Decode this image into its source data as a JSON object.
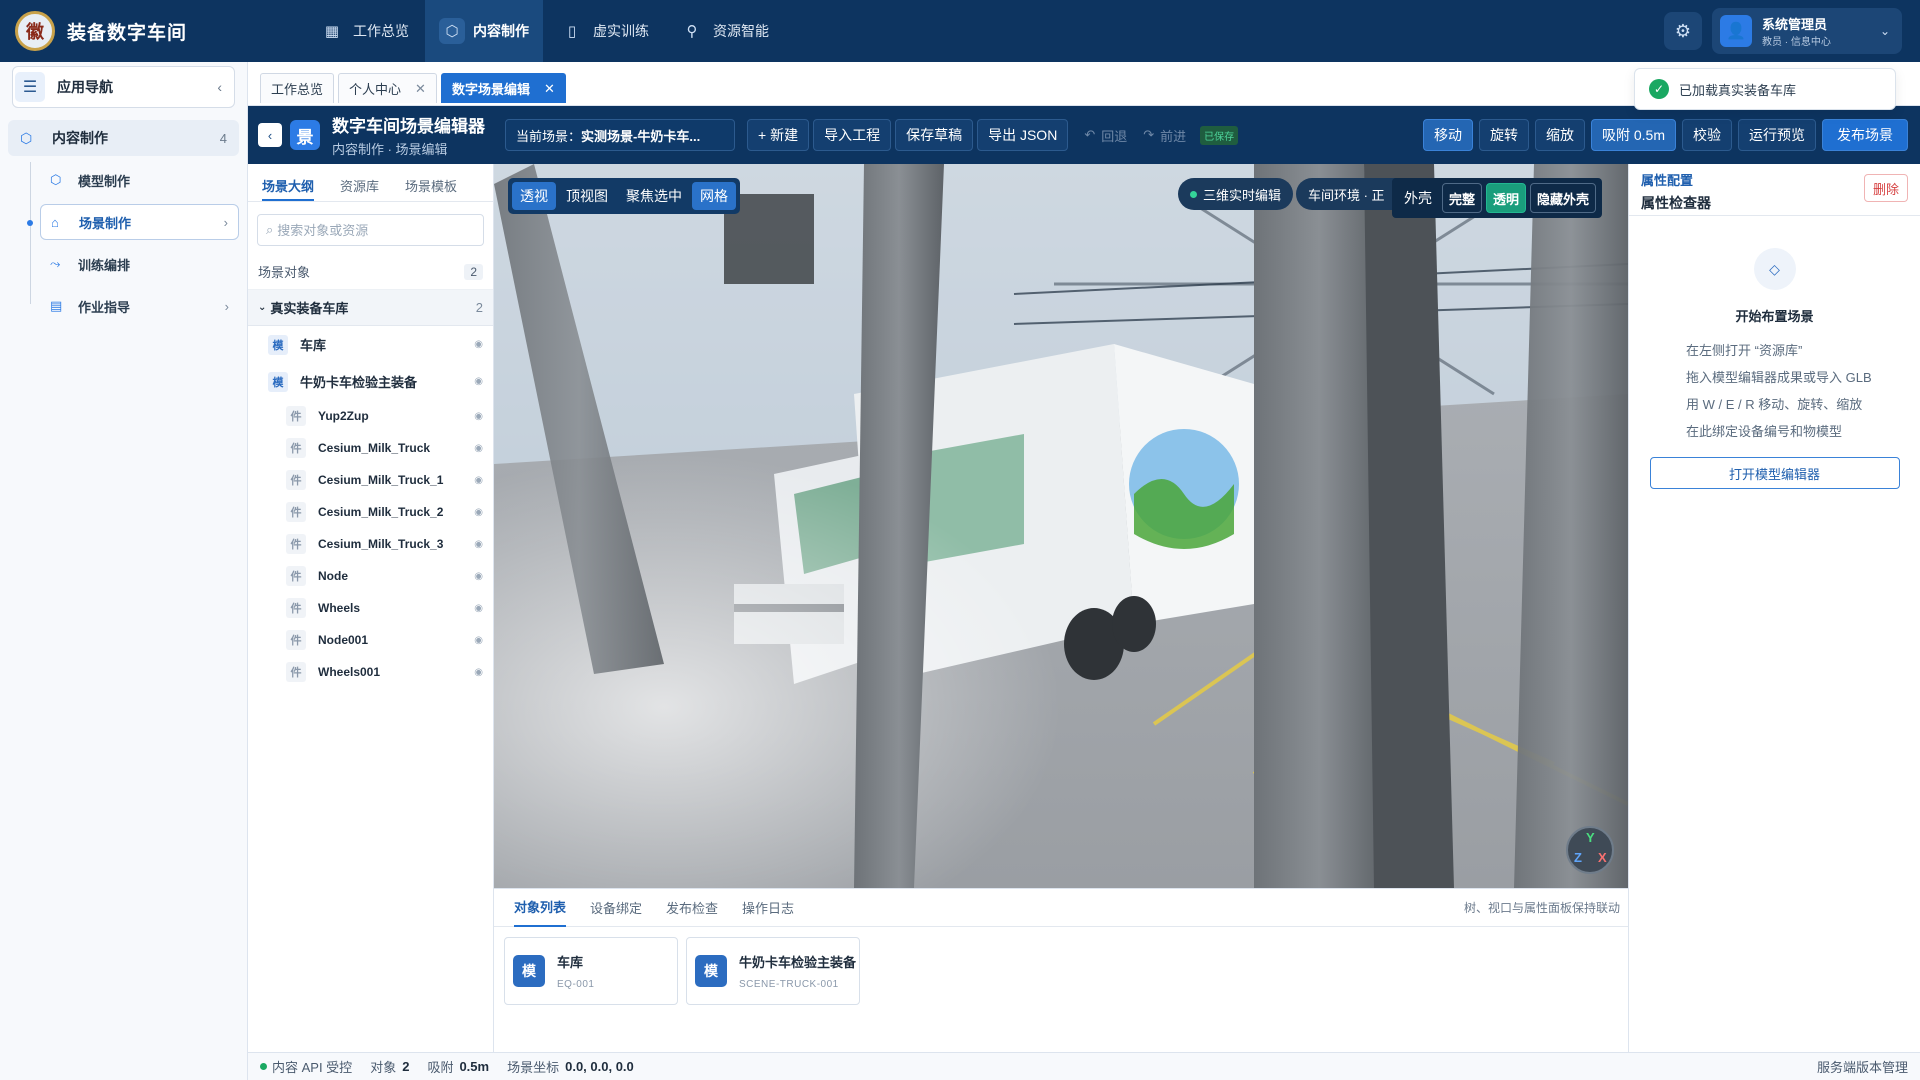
{
  "app": {
    "title": "装备数字车间",
    "logo_text": "徽"
  },
  "topnav": [
    {
      "icon": "grid-icon",
      "label": "工作总览",
      "active": false
    },
    {
      "icon": "cube-icon",
      "label": "内容制作",
      "active": true
    },
    {
      "icon": "book-icon",
      "label": "虚实训练",
      "active": false
    },
    {
      "icon": "plug-icon",
      "label": "资源智能",
      "active": false
    }
  ],
  "user": {
    "name": "系统管理员",
    "role": "教员 · 信息中心"
  },
  "sidebar": {
    "title": "应用导航",
    "group": {
      "label": "内容制作",
      "count": "4"
    },
    "items": [
      {
        "icon": "cube-icon",
        "label": "模型制作",
        "active": false,
        "has_children": false
      },
      {
        "icon": "home-icon",
        "label": "场景制作",
        "active": true,
        "has_children": true
      },
      {
        "icon": "route-icon",
        "label": "训练编排",
        "active": false,
        "has_children": false
      },
      {
        "icon": "document-icon",
        "label": "作业指导",
        "active": false,
        "has_children": true
      }
    ]
  },
  "tabs": [
    {
      "label": "工作总览",
      "closable": false,
      "active": false
    },
    {
      "label": "个人中心",
      "closable": true,
      "active": false
    },
    {
      "label": "数字场景编辑",
      "closable": true,
      "active": true
    }
  ],
  "toast": {
    "text": "已加载真实装备车库"
  },
  "editor": {
    "icon_text": "景",
    "title": "数字车间场景编辑器",
    "subtitle": "内容制作 · 场景编辑",
    "scene_prefix": "当前场景：",
    "scene_name": "实测场景-牛奶卡车...",
    "buttons": [
      "+ 新建",
      "导入工程",
      "保存草稿",
      "导出 JSON"
    ],
    "undo": "回退",
    "redo": "前进",
    "saved": "已保存",
    "right_buttons": [
      {
        "label": "移动",
        "selected": true
      },
      {
        "label": "旋转",
        "selected": false
      },
      {
        "label": "缩放",
        "selected": false
      },
      {
        "label": "吸附 0.5m",
        "selected": true
      },
      {
        "label": "校验",
        "selected": false
      },
      {
        "label": "运行预览",
        "selected": false
      }
    ],
    "publish": "发布场景"
  },
  "outline": {
    "tabs": [
      {
        "label": "场景大纲",
        "active": true
      },
      {
        "label": "资源库",
        "active": false
      },
      {
        "label": "场景模板",
        "active": false
      }
    ],
    "search_placeholder": "搜索对象或资源",
    "section": {
      "label": "场景对象",
      "count": "2"
    },
    "root": {
      "label": "真实装备车库",
      "count": "2"
    },
    "nodes": [
      {
        "tag": "模",
        "label": "车库",
        "level": 1
      },
      {
        "tag": "模",
        "label": "牛奶卡车检验主装备",
        "level": 1
      },
      {
        "tag": "件",
        "label": "Yup2Zup",
        "level": 2
      },
      {
        "tag": "件",
        "label": "Cesium_Milk_Truck",
        "level": 2
      },
      {
        "tag": "件",
        "label": "Cesium_Milk_Truck_1",
        "level": 2
      },
      {
        "tag": "件",
        "label": "Cesium_Milk_Truck_2",
        "level": 2
      },
      {
        "tag": "件",
        "label": "Cesium_Milk_Truck_3",
        "level": 2
      },
      {
        "tag": "件",
        "label": "Node",
        "level": 2
      },
      {
        "tag": "件",
        "label": "Wheels",
        "level": 2
      },
      {
        "tag": "件",
        "label": "Node001",
        "level": 2
      },
      {
        "tag": "件",
        "label": "Wheels001",
        "level": 2
      }
    ]
  },
  "viewport": {
    "views": [
      {
        "label": "透视",
        "selected": true
      },
      {
        "label": "顶视图",
        "selected": false
      },
      {
        "label": "聚焦选中",
        "selected": false
      },
      {
        "label": "网格",
        "selected": true
      }
    ],
    "live_edit": "三维实时编辑",
    "environment": "车间环境 · 正",
    "shell_label": "外壳",
    "shell_options": [
      {
        "label": "完整",
        "selected": false
      },
      {
        "label": "透明",
        "selected": true
      },
      {
        "label": "隐藏外壳",
        "selected": false
      }
    ],
    "gizmo": {
      "y": "Y",
      "z": "Z",
      "x": "X"
    }
  },
  "bottom": {
    "tabs": [
      {
        "label": "对象列表",
        "active": true
      },
      {
        "label": "设备绑定",
        "active": false
      },
      {
        "label": "发布检查",
        "active": false
      },
      {
        "label": "操作日志",
        "active": false
      }
    ],
    "note": "树、视口与属性面板保持联动",
    "cards": [
      {
        "tag": "模",
        "name": "车库",
        "code": "EQ-001"
      },
      {
        "tag": "模",
        "name": "牛奶卡车检验主装备",
        "code": "SCENE-TRUCK-001"
      }
    ]
  },
  "inspector": {
    "title": "属性配置",
    "subtitle": "属性检查器",
    "delete": "删除",
    "empty_title": "开始布置场景",
    "hints": [
      "在左侧打开 “资源库”",
      "拖入模型编辑器成果或导入 GLB",
      "用 W / E / R 移动、旋转、缩放",
      "在此绑定设备编号和物模型"
    ],
    "open_button": "打开模型编辑器"
  },
  "status": {
    "api": "内容 API 受控",
    "objects_label": "对象",
    "objects_value": "2",
    "snap_label": "吸附",
    "snap_value": "0.5m",
    "coord_label": "场景坐标",
    "coord_value": "0.0, 0.0, 0.0",
    "right": "服务端版本管理"
  },
  "colors": {
    "brand": "#0d3460",
    "accent": "#1f6fd1",
    "success": "#1aa862",
    "danger": "#d64040"
  }
}
